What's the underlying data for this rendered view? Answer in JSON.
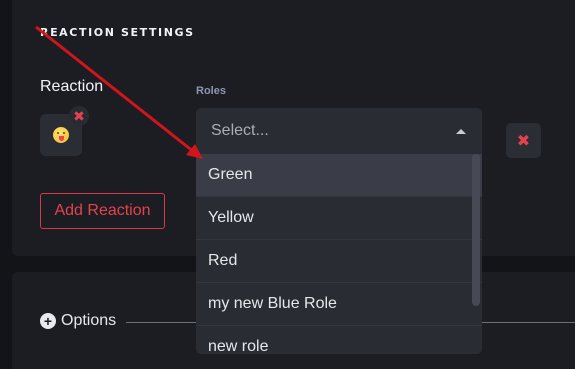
{
  "section_title": "REACTION SETTINGS",
  "reaction": {
    "label": "Reaction",
    "emoji_icon": "face-with-tongue-emoji",
    "remove_symbol": "✖"
  },
  "roles": {
    "label": "Roles",
    "placeholder": "Select...",
    "options": [
      "Green",
      "Yellow",
      "Red",
      "my new Blue Role",
      "new role"
    ],
    "highlighted_option": "Green"
  },
  "delete_symbol": "✖",
  "add_reaction_label": "Add Reaction",
  "options_section": {
    "icon": "plus-circle-icon",
    "label": "Options"
  },
  "colors": {
    "accent_red": "#e5424f",
    "annotation_arrow": "#d0151b"
  }
}
